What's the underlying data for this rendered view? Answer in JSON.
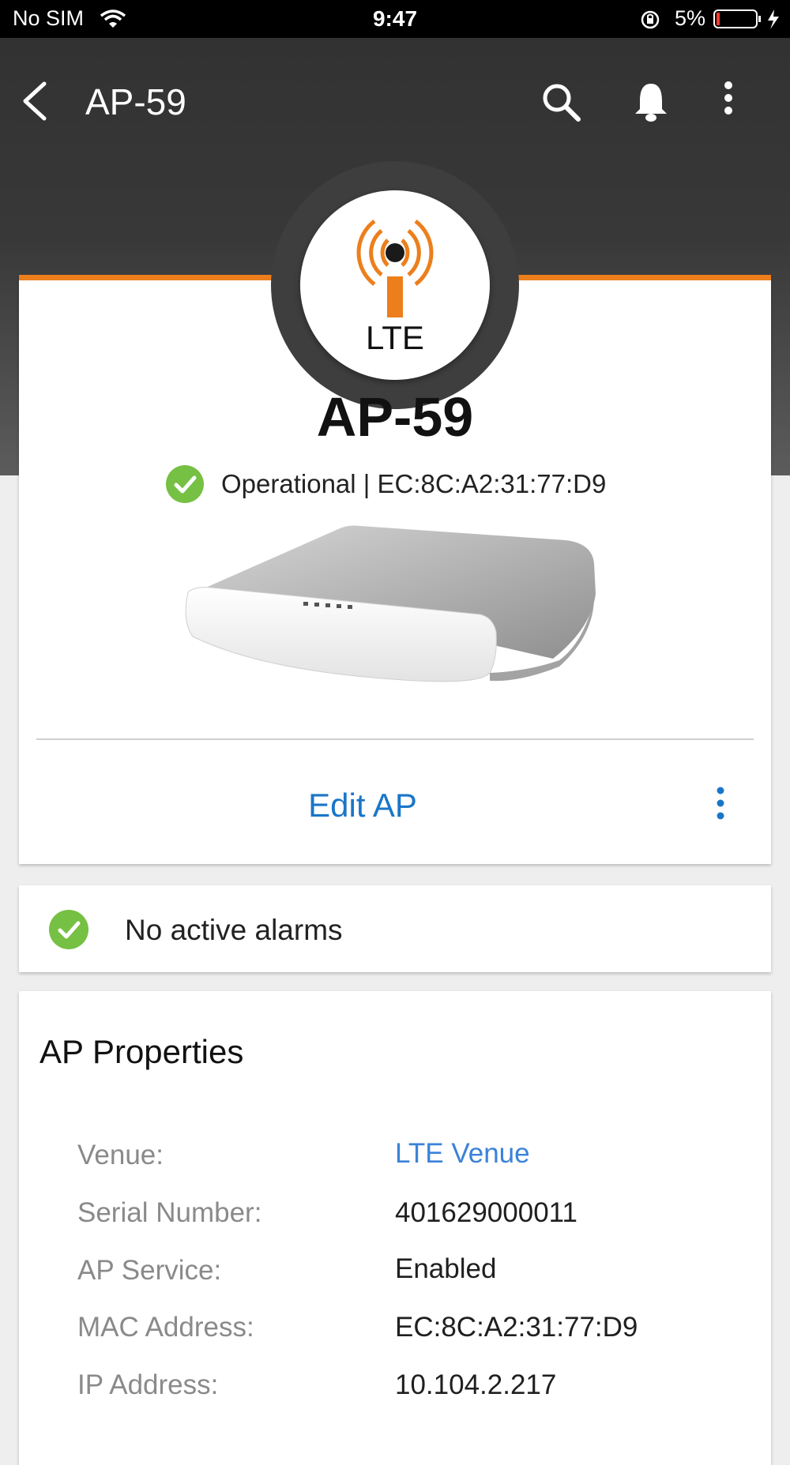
{
  "status_bar": {
    "carrier": "No SIM",
    "time": "9:47",
    "battery_percent": "5%"
  },
  "app_bar": {
    "title": "AP-59",
    "icons": [
      "back-arrow-icon",
      "search-icon",
      "bell-icon",
      "more-vert-icon"
    ]
  },
  "hero": {
    "logo_text": "LTE",
    "name": "AP-59",
    "status_text": "Operational | EC:8C:A2:31:77:D9",
    "edit_label": "Edit AP",
    "accent_color": "#ec7f1c",
    "link_color": "#1a76c8",
    "ok_color": "#76c043"
  },
  "alarms": {
    "text": "No active alarms"
  },
  "properties": {
    "title": "AP Properties",
    "rows": [
      {
        "label": "Venue:",
        "value": "LTE Venue",
        "link": true
      },
      {
        "label": "Serial Number:",
        "value": "401629000011"
      },
      {
        "label": "AP Service:",
        "value": "Enabled"
      },
      {
        "label": "MAC Address:",
        "value": "EC:8C:A2:31:77:D9"
      },
      {
        "label": "IP Address:",
        "value": "10.104.2.217"
      }
    ]
  }
}
